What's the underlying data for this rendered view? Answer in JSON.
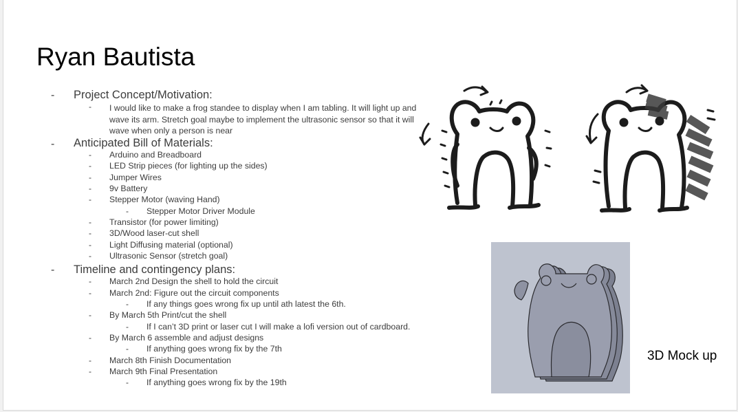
{
  "title": "Ryan Bautista",
  "sections": [
    {
      "heading": "Project Concept/Motivation:",
      "paragraph": "I would like to make a frog standee to display when I am tabling. It will light up and wave its arm. Stretch goal maybe to implement the ultrasonic sensor so that it will wave when only a person is near"
    },
    {
      "heading": "Anticipated Bill of Materials:",
      "items": [
        "Arduino and Breadboard",
        "LED Strip pieces (for lighting up the sides)",
        "Jumper Wires",
        "9v Battery",
        "Stepper Motor (waving Hand)",
        "Stepper Motor Driver Module",
        "Transistor (for power limiting)",
        "3D/Wood laser-cut shell",
        "Light Diffusing material (optional)",
        "Ultrasonic Sensor (stretch goal)"
      ]
    },
    {
      "heading": "Timeline and contingency plans:",
      "items": [
        "March 2nd Design the shell to hold the circuit",
        "March 2nd: Figure out the circuit components",
        "If any things goes wrong fix up until ath latest the 6th.",
        "By March 5th Print/cut the shell",
        "If I can’t 3D print or laser cut I will make a lofi version out of cardboard.",
        "By March 6 assemble and adjust designs",
        "If anything goes wrong fix by the 7th",
        "March 8th Finish Documentation",
        "March 9th Final Presentation",
        "If anything goes wrong fix by the 19th"
      ]
    }
  ],
  "bullet": "-",
  "caption": "3D Mock up",
  "colors": {
    "text": "#3c3c3c",
    "mock_bg": "#bec3cf",
    "mock_body": "#8e92a2"
  }
}
